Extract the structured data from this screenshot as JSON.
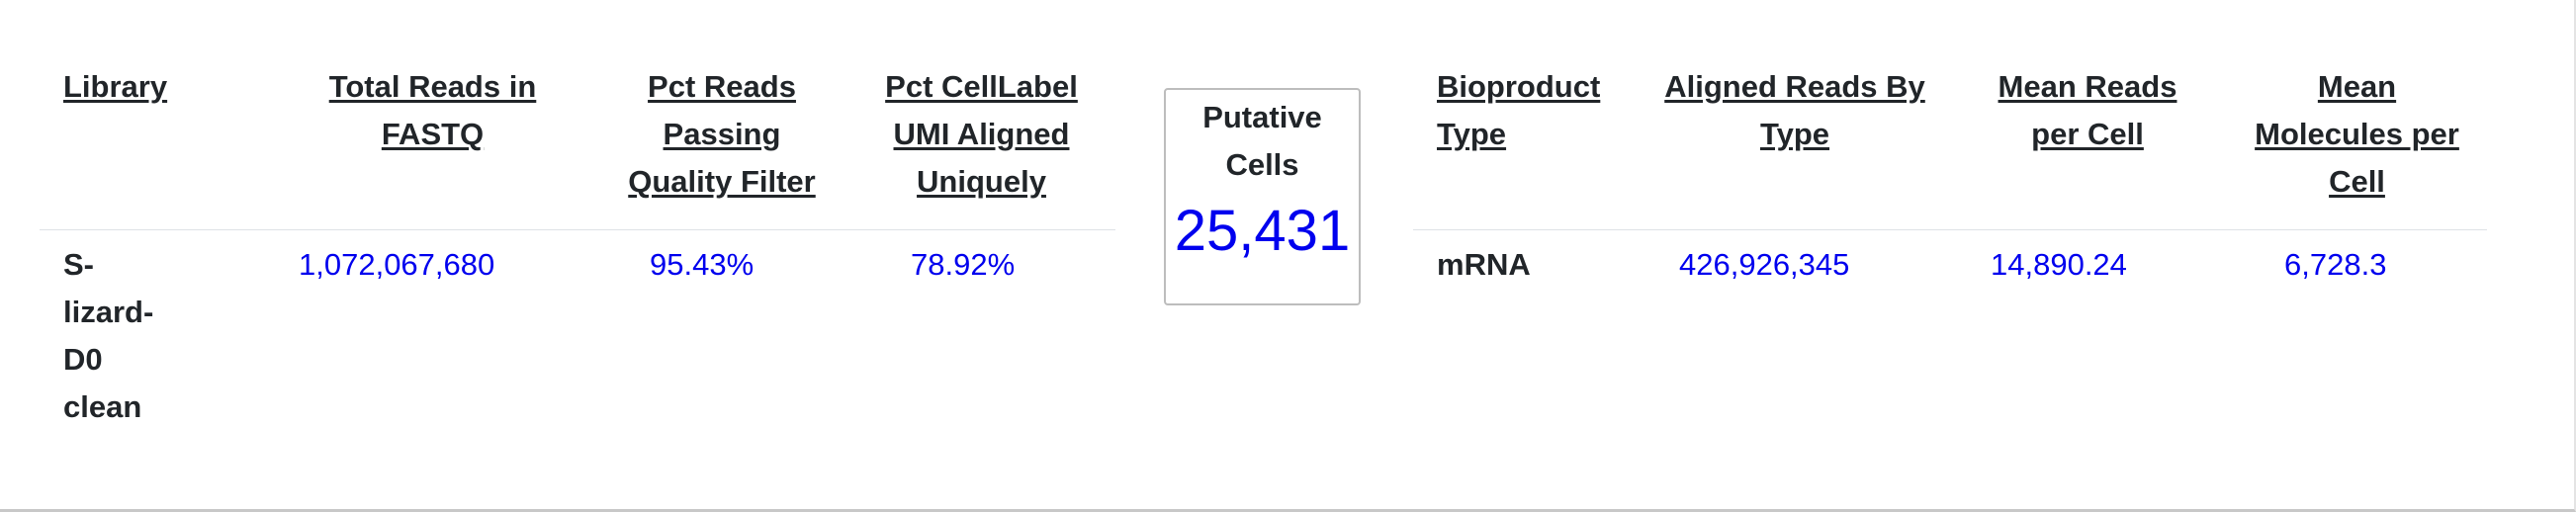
{
  "library_table": {
    "headers": {
      "library": "Library",
      "total_reads_line1": "Total Reads in",
      "total_reads_line2": "FASTQ",
      "pct_passing_line1": "Pct Reads",
      "pct_passing_line2": "Passing",
      "pct_passing_line3": "Quality Filter",
      "pct_celllabel_line1": "Pct CellLabel",
      "pct_celllabel_line2": "UMI Aligned",
      "pct_celllabel_line3": "Uniquely"
    },
    "row": {
      "library_line1": "S-",
      "library_line2": "lizard-",
      "library_line3": "D0",
      "library_line4": "clean",
      "total_reads": "1,072,067,680",
      "pct_passing": "95.43%",
      "pct_celllabel": "78.92%"
    }
  },
  "putative_cells": {
    "label_line1": "Putative",
    "label_line2": "Cells",
    "value": "25,431"
  },
  "bioproduct_table": {
    "headers": {
      "bioproduct_line1": "Bioproduct",
      "bioproduct_line2": "Type",
      "aligned_line1": "Aligned Reads By",
      "aligned_line2": "Type",
      "mean_reads_line1": "Mean Reads",
      "mean_reads_line2": "per Cell",
      "mean_mol_line1": "Mean",
      "mean_mol_line2": "Molecules per",
      "mean_mol_line3": "Cell"
    },
    "row": {
      "bioproduct_type": "mRNA",
      "aligned_reads": "426,926,345",
      "mean_reads": "14,890.24",
      "mean_molecules": "6,728.3"
    }
  },
  "colors": {
    "value_blue": "#0000ee",
    "text_dark": "#212529",
    "rule": "#dee2e6",
    "box_border": "#bdbdbd"
  }
}
